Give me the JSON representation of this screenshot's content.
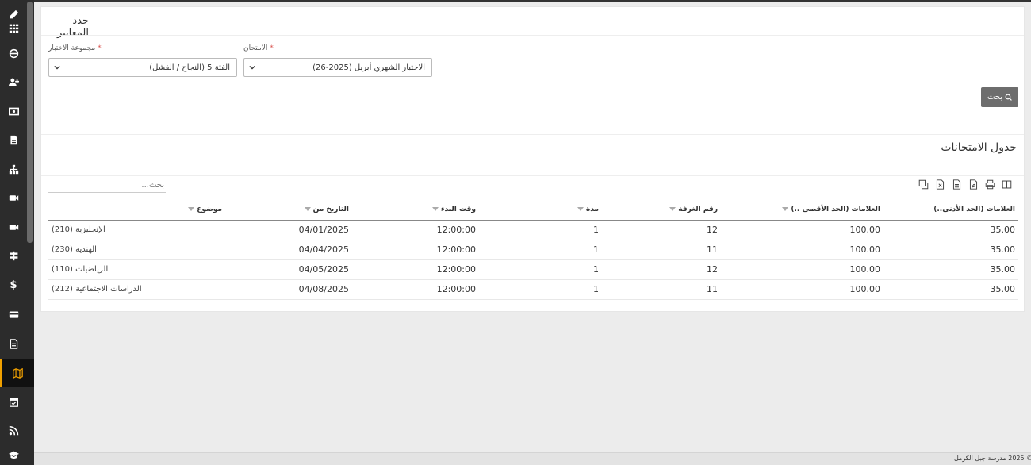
{
  "sidebar": {
    "items": [
      {
        "icon": "pencil-grid-icon"
      },
      {
        "icon": "globe-icon"
      },
      {
        "icon": "user-add-icon"
      },
      {
        "icon": "money-icon"
      },
      {
        "icon": "document-edit-icon"
      },
      {
        "icon": "sitemap-icon"
      },
      {
        "icon": "video-camera-icon"
      },
      {
        "icon": "video-camera-icon"
      },
      {
        "icon": "signpost-icon"
      },
      {
        "icon": "dollar-icon"
      },
      {
        "icon": "credit-card-icon"
      },
      {
        "icon": "document-list-icon"
      },
      {
        "icon": "map-icon",
        "active": true
      },
      {
        "icon": "calendar-check-icon"
      },
      {
        "icon": "rss-icon"
      },
      {
        "icon": "graduation-cap-icon"
      }
    ],
    "accent_color": "#f0a000"
  },
  "criteria": {
    "title": "حدد المعايير",
    "exam_label": "الامتحان",
    "exam_value": "الاختبار الشهري أبريل (2025-26)",
    "group_label": "مجموعة الاختبار",
    "group_value": "الفئة 5 (النجاح / الفشل)",
    "search_button": "بحث"
  },
  "schedule": {
    "title": "جدول الامتحانات",
    "search_placeholder": "بحث...",
    "columns": {
      "min_marks": "العلامات (الحد الأدنى..)",
      "max_marks": "العلامات (الحد الأقصى ..)",
      "room": "رقم الغرفة",
      "duration": "مدة",
      "start_time": "وقت البدء",
      "date_from": "التاريخ من",
      "subject": "موضوع"
    },
    "rows": [
      {
        "min_marks": "35.00",
        "max_marks": "100.00",
        "room": "12",
        "duration": "1",
        "start_time": "12:00:00",
        "date_from": "04/01/2025",
        "subject": "الإنجليزية (210)"
      },
      {
        "min_marks": "35.00",
        "max_marks": "100.00",
        "room": "11",
        "duration": "1",
        "start_time": "12:00:00",
        "date_from": "04/04/2025",
        "subject": "الهندية (230)"
      },
      {
        "min_marks": "35.00",
        "max_marks": "100.00",
        "room": "12",
        "duration": "1",
        "start_time": "12:00:00",
        "date_from": "04/05/2025",
        "subject": "الرياضيات (110)"
      },
      {
        "min_marks": "35.00",
        "max_marks": "100.00",
        "room": "11",
        "duration": "1",
        "start_time": "12:00:00",
        "date_from": "04/08/2025",
        "subject": "الدراسات الاجتماعية (212)"
      }
    ]
  },
  "footer": {
    "text": "© 2025 مدرسة جبل الكرمل"
  }
}
